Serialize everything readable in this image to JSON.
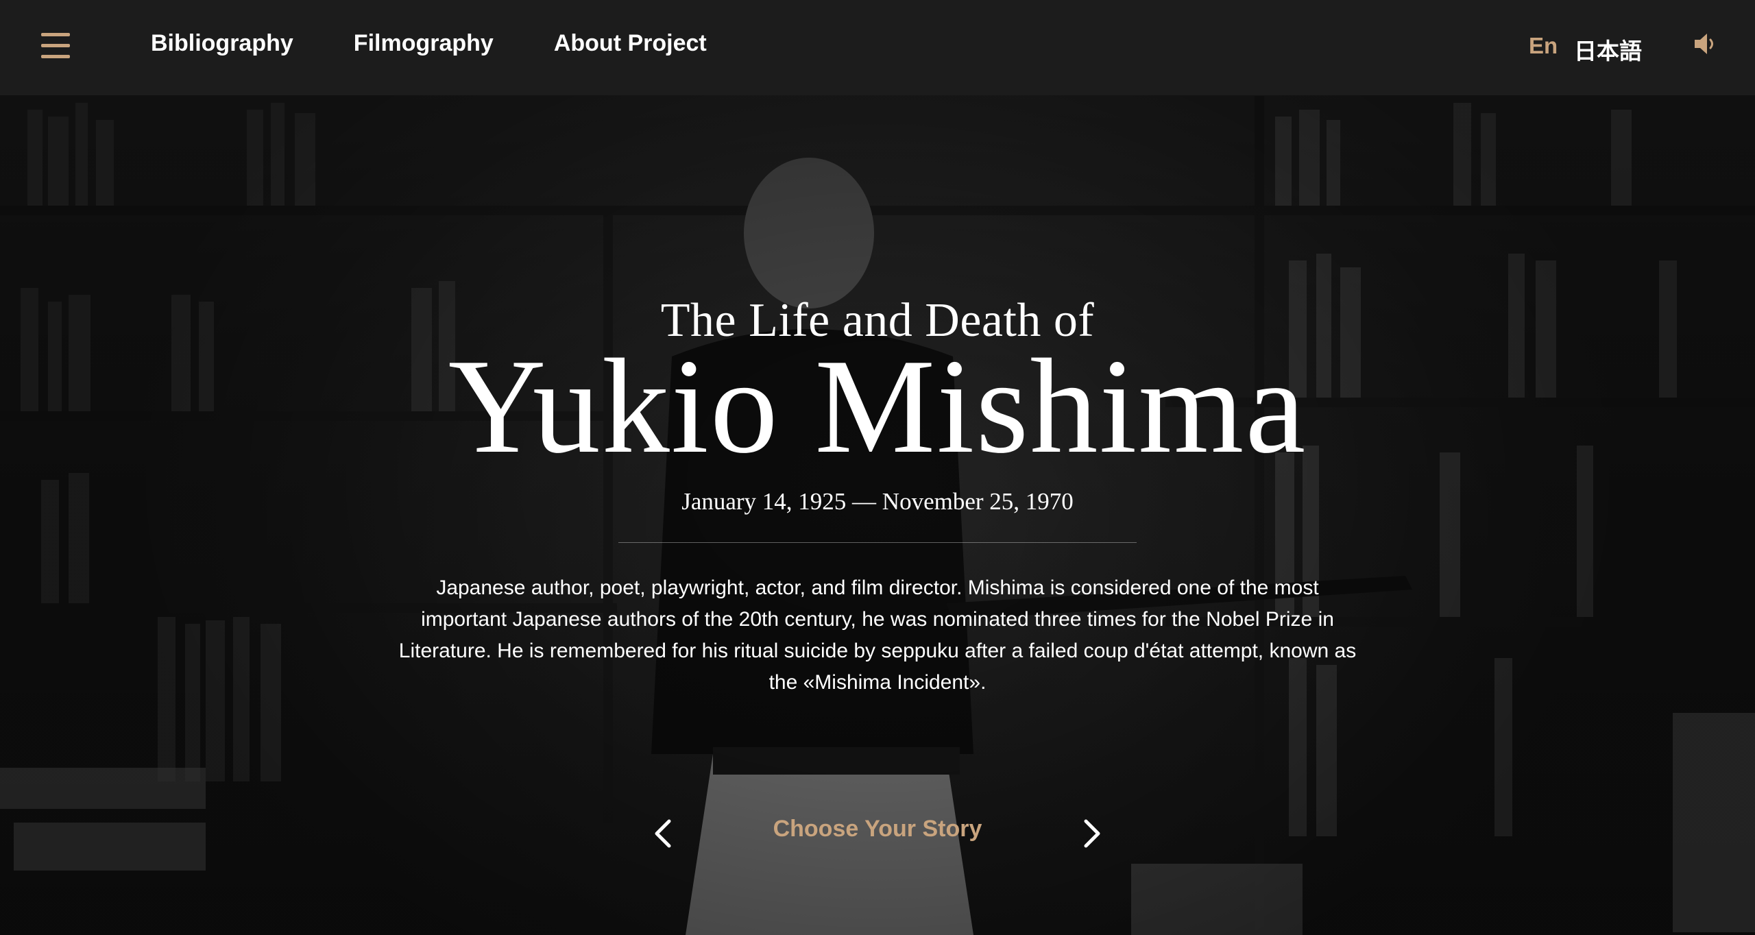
{
  "nav": {
    "menu_icon": "hamburger-menu-icon",
    "links": [
      {
        "label": "Bibliography"
      },
      {
        "label": "Filmography"
      },
      {
        "label": "About Project"
      }
    ],
    "languages": {
      "en": "En",
      "ja": "日本語",
      "active": "En"
    },
    "sound_icon": "speaker-icon"
  },
  "hero": {
    "pre_title": "The Life and Death of",
    "title": "Yukio Mishima",
    "dates": "January 14, 1925 — November 25, 1970",
    "description": "Japanese author, poet, playwright, actor, and film director. Mishima is considered one of the most important Japanese authors of the 20th century, he was nominated three times for the Nobel Prize in Literature. He is remembered for his ritual suicide by seppuku after a failed coup d'état attempt, known as the «Mishima Incident»."
  },
  "story_chooser": {
    "label": "Choose Your Story",
    "prev_icon": "chevron-left-icon",
    "next_icon": "chevron-right-icon"
  },
  "colors": {
    "accent": "#c9a47e",
    "nav_background": "#1c1c1c",
    "text": "#ffffff"
  }
}
